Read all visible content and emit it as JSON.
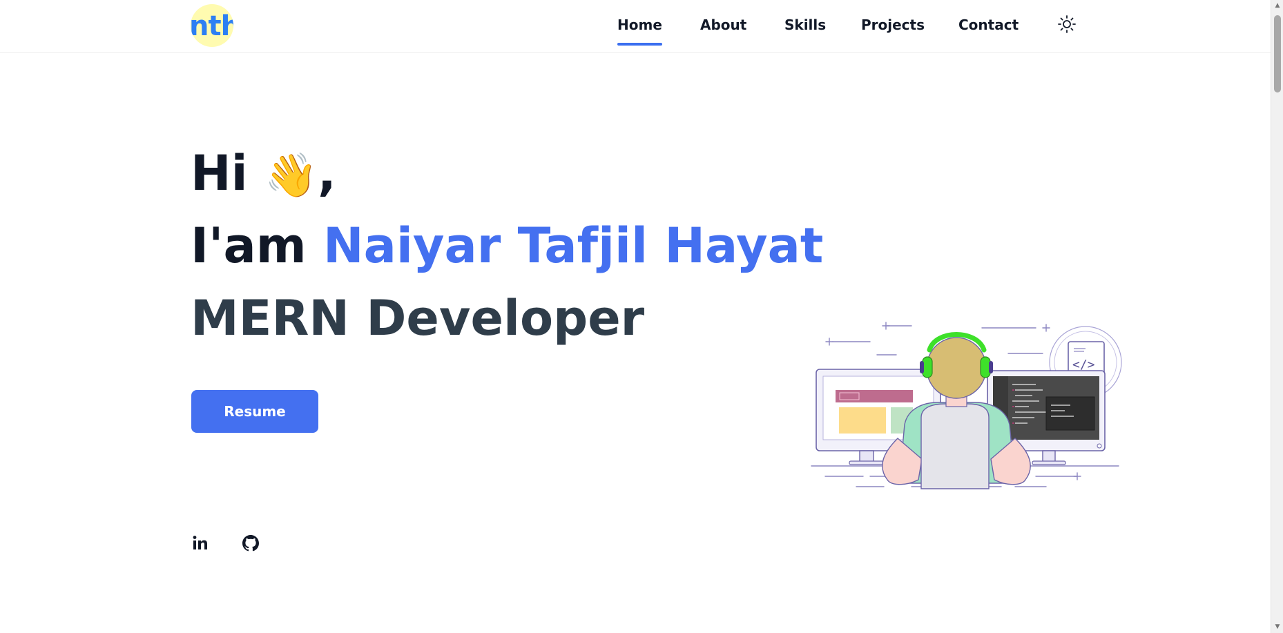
{
  "header": {
    "logo_text": "nth",
    "nav": [
      {
        "label": "Home",
        "active": true
      },
      {
        "label": "About",
        "active": false
      },
      {
        "label": "Skills",
        "active": false
      },
      {
        "label": "Projects",
        "active": false
      },
      {
        "label": "Contact",
        "active": false
      }
    ],
    "theme_toggle_icon": "sun-icon"
  },
  "hero": {
    "greeting": "Hi",
    "wave_emoji": "👋",
    "comma": ",",
    "intro": "I'am",
    "name": "Naiyar Tafjil Hayat",
    "role": "MERN Developer",
    "resume_label": "Resume"
  },
  "social": [
    {
      "icon": "linkedin-icon",
      "label": "in"
    },
    {
      "icon": "github-icon"
    }
  ],
  "colors": {
    "accent": "#4470f0",
    "text": "#111827",
    "role_text": "#2f3d4a",
    "logo_bg": "#fffbb0",
    "logo_text": "#2d7ff3"
  }
}
